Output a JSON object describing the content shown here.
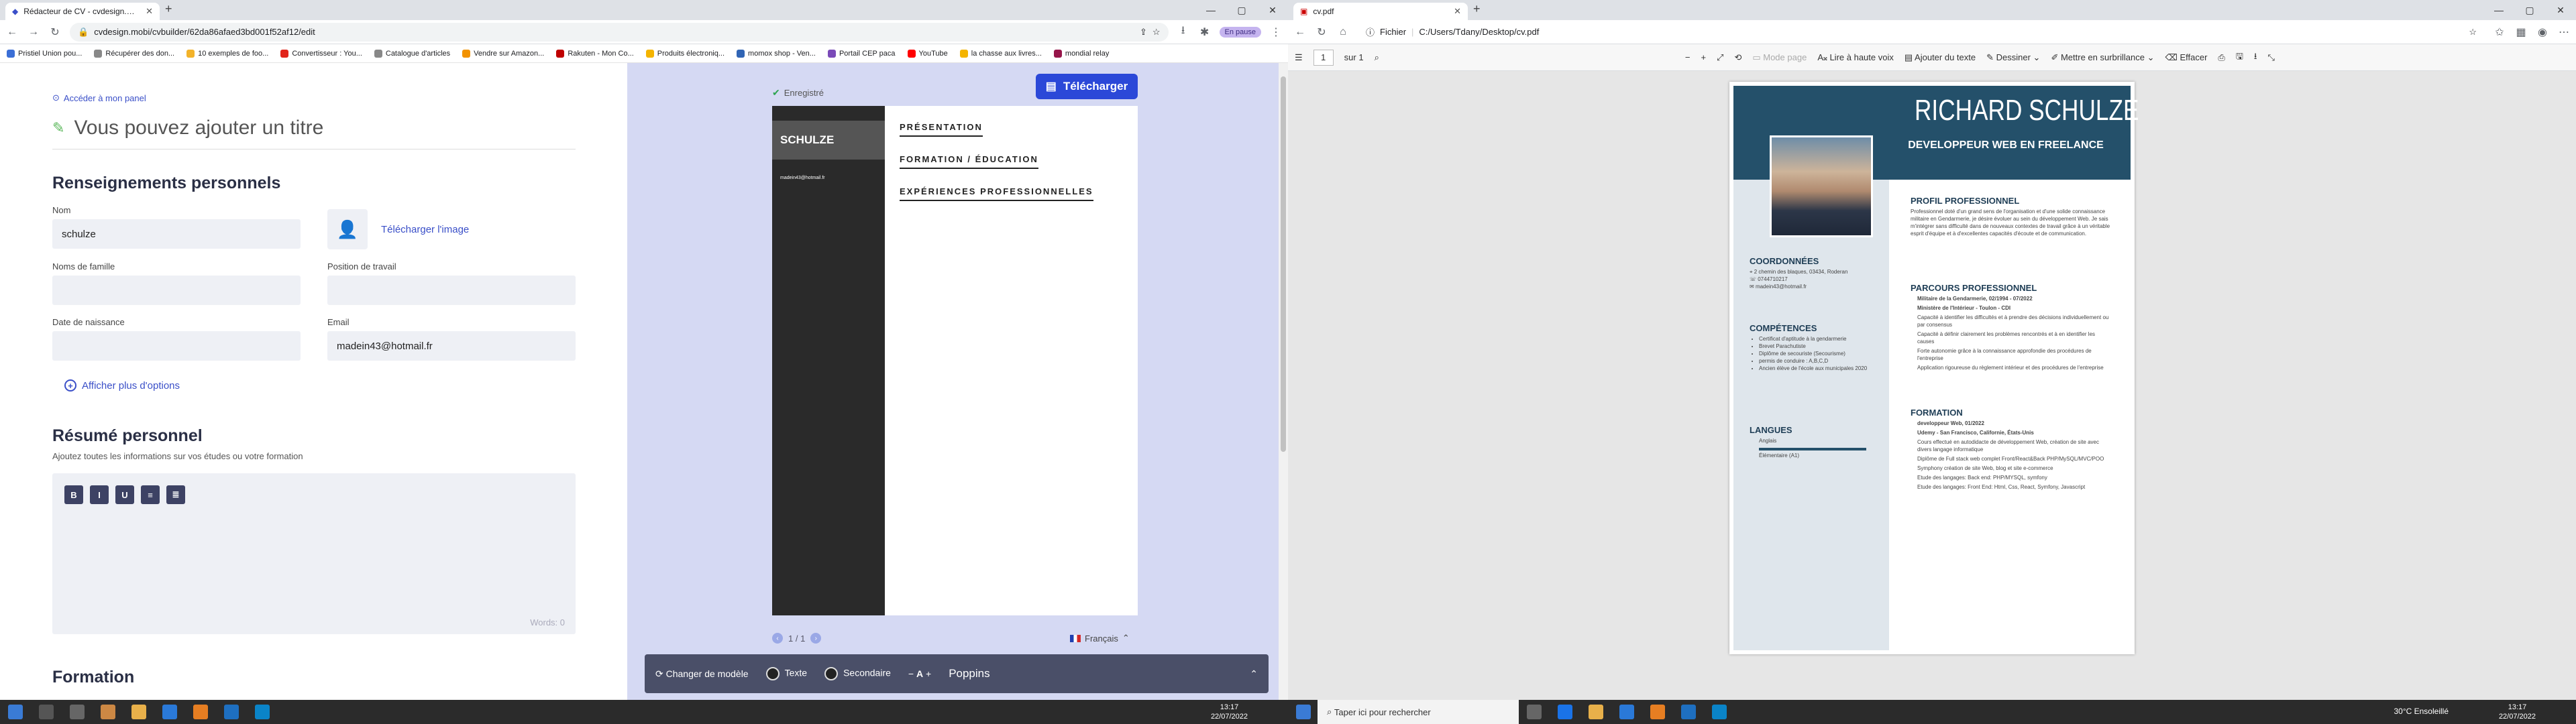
{
  "left_browser": {
    "tab_title": "Rédacteur de CV - cvdesign.mobi",
    "url": "cvdesign.mobi/cvbuilder/62da86afaed3bd001f52af12/edit",
    "pause_label": "En pause",
    "bookmarks": [
      {
        "label": "Pristiel Union pou...",
        "color": "#3b6fd6"
      },
      {
        "label": "Récupérer des don...",
        "color": "#888"
      },
      {
        "label": "10 exemples de foo...",
        "color": "#f3b32a"
      },
      {
        "label": "Convertisseur : You...",
        "color": "#e1251b"
      },
      {
        "label": "Catalogue d'articles",
        "color": "#888"
      },
      {
        "label": "Vendre sur Amazon...",
        "color": "#f29200"
      },
      {
        "label": "Rakuten - Mon Co...",
        "color": "#bf0000"
      },
      {
        "label": "Produits électroniq...",
        "color": "#f4b400"
      },
      {
        "label": "momox shop - Ven...",
        "color": "#3165b5"
      },
      {
        "label": "Portail CEP paca",
        "color": "#7a4ab8"
      },
      {
        "label": "YouTube",
        "color": "#ff0000"
      },
      {
        "label": "la chasse aux livres...",
        "color": "#f4b400"
      },
      {
        "label": "mondial relay",
        "color": "#96154a"
      }
    ]
  },
  "editor": {
    "back_link": "Accéder à mon panel",
    "title_placeholder": "Vous pouvez ajouter un titre",
    "personal_heading": "Renseignements personnels",
    "fields": {
      "first_name_label": "Nom",
      "first_name_value": "schulze",
      "photo_link": "Télécharger l'image",
      "last_name_label": "Noms de famille",
      "last_name_value": "",
      "job_label": "Position de travail",
      "job_value": "",
      "birth_label": "Date de naissance",
      "birth_value": "",
      "email_label": "Email",
      "email_value": "madein43@hotmail.fr"
    },
    "more_options": "Afficher plus d'options",
    "summary_heading": "Résumé personnel",
    "summary_hint": "Ajoutez toutes les informations sur vos études ou votre formation",
    "rte_buttons": [
      "B",
      "I",
      "U",
      "≡",
      "≣"
    ],
    "word_count": "Words: 0",
    "formation_heading": "Formation"
  },
  "preview": {
    "saved_label": "Enregistré",
    "download_label": "Télécharger",
    "cv_name": "SCHULZE",
    "cv_email": "madein43@hotmail.fr",
    "sections": [
      "PRÉSENTATION",
      "FORMATION / ÉDUCATION",
      "EXPÉRIENCES PROFESSIONNELLES"
    ],
    "pager": "1 / 1",
    "language": "Français",
    "bottom": {
      "template_label": "Changer de modèle",
      "text_label": "Texte",
      "secondary_label": "Secondaire",
      "font_minus": "A",
      "font_name": "Poppins"
    }
  },
  "right_browser": {
    "tab_title": "cv.pdf",
    "scheme_label": "Fichier",
    "url": "C:/Users/Tdany/Desktop/cv.pdf",
    "page_input": "1",
    "page_total": "sur 1",
    "tools": {
      "page_mode": "Mode page",
      "read_aloud": "Lire à haute voix",
      "add_text": "Ajouter du texte",
      "draw": "Dessiner",
      "highlight": "Mettre en surbrillance",
      "erase": "Effacer"
    }
  },
  "cv_pdf": {
    "name": "RICHARD SCHULZE",
    "subtitle": "DEVELOPPEUR WEB EN FREELANCE",
    "profile_heading": "PROFIL PROFESSIONNEL",
    "profile_text": "Professionnel doté d'un grand sens de l'organisation et d'une solide connaissance militaire en Gendarmerie, je désire évoluer au sein du développement Web. Je sais m'intégrer sans difficulté dans de nouveaux contextes de travail grâce à un véritable esprit d'équipe et à d'excellentes capacités d'écoute et de communication.",
    "contact_heading": "COORDONNÉES",
    "contact": [
      "2 chemin des blaques, 03434, Roderan",
      "0744710217",
      "madein43@hotmail.fr"
    ],
    "skills_heading": "COMPÉTENCES",
    "skills": [
      "Certificat d'aptitude à la gendarmerie",
      "Brevet Parachutiste",
      "Diplôme de secouriste (Secourisme)",
      "permis de conduire : A,B,C,D",
      "Ancien élève de l'école aux municipales 2020"
    ],
    "languages_heading": "LANGUES",
    "language": "Anglais",
    "language_level": "Élémentaire (A1)",
    "career_heading": "PARCOURS PROFESSIONNEL",
    "career_lines": [
      "Militaire de la Gendarmerie, 02/1994 - 07/2022",
      "Ministère de l'Intérieur - Toulon - CDI",
      "Capacité à identifier les difficultés et à prendre des décisions individuellement ou par consensus",
      "Capacité à définir clairement les problèmes rencontrés et à en identifier les causes",
      "Forte autonomie grâce à la connaissance approfondie des procédures de l'entreprise",
      "Application rigoureuse du règlement intérieur et des procédures de l'entreprise"
    ],
    "formation_heading": "FORMATION",
    "formation_lines": [
      "developpeur Web, 01/2022",
      "Udemy - San Francisco, Californie, États-Unis",
      "Cours effectué en autodidacte de développement Web, création de site avec divers langage informatique",
      "Diplôme de Full stack web complet Front/React&Back PHP/MySQL/MVC/POO",
      "Symphony création de site Web, blog et site e-commerce",
      "Etude des langages: Back end: PHP/MYSQL, symfony",
      "Etude des langages: Front End: Html, Css, React, Symfony, Javascript"
    ]
  },
  "taskbar": {
    "time": "13:17",
    "date": "22/07/2022",
    "search_placeholder": "Taper ici pour rechercher",
    "weather": "30°C  Ensoleillé"
  }
}
